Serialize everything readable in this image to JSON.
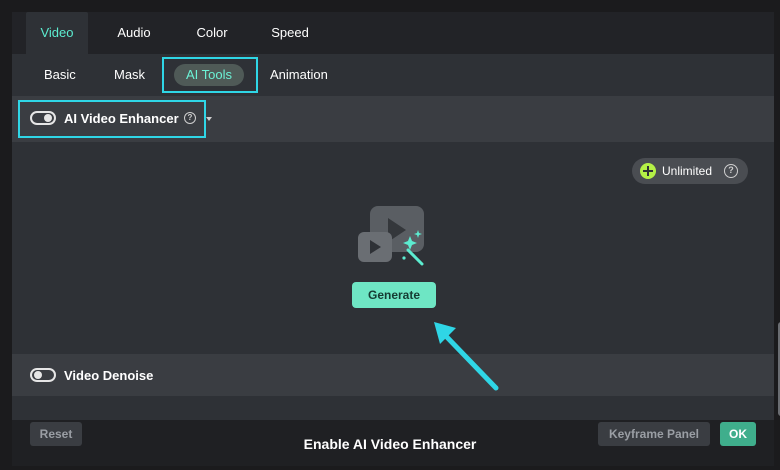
{
  "tabs": [
    {
      "label": "Video",
      "active": true
    },
    {
      "label": "Audio",
      "active": false
    },
    {
      "label": "Color",
      "active": false
    },
    {
      "label": "Speed",
      "active": false
    }
  ],
  "subtabs": [
    {
      "label": "Basic",
      "active": false
    },
    {
      "label": "Mask",
      "active": false
    },
    {
      "label": "AI Tools",
      "active": true
    },
    {
      "label": "Animation",
      "active": false
    }
  ],
  "enhancer": {
    "label": "AI Video Enhancer",
    "enabled": true,
    "help_icon": "question-circle-icon",
    "unlimited_label": "Unlimited",
    "generate_label": "Generate",
    "art_icon": "ai-video-enhance-icon"
  },
  "denoise": {
    "label": "Video Denoise",
    "enabled": false
  },
  "footer": {
    "reset_label": "Reset",
    "keyframe_label": "Keyframe Panel",
    "ok_label": "OK"
  },
  "caption": "Enable AI Video Enhancer",
  "colors": {
    "accent": "#5cecd0",
    "highlight": "#2fd6e6",
    "generate_bg": "#6ee6c4",
    "ok_bg": "#3fae8c",
    "unlimited_badge": "#b4f046"
  }
}
